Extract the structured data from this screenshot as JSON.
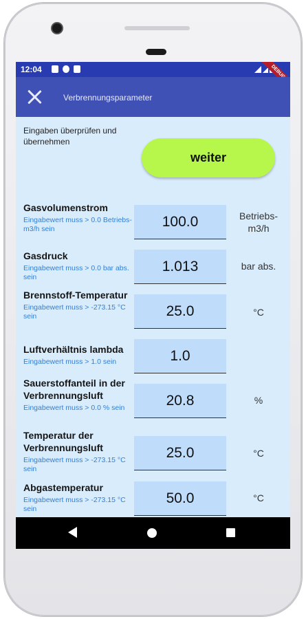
{
  "status_bar": {
    "time": "12:04",
    "debug_banner": "DEBUG"
  },
  "app_bar": {
    "title": "Verbrennungsparameter"
  },
  "hint": "Eingaben überprüfen und übernehmen",
  "weiter_label": "weiter",
  "params": [
    {
      "label": "Gasvolumenstrom",
      "hint": "Eingabewert muss > 0.0 Betriebs-m3/h sein",
      "value": "100.0",
      "unit": "Betriebs-m3/h"
    },
    {
      "label": "Gasdruck",
      "hint": "Eingabewert muss > 0.0 bar abs. sein",
      "value": "1.013",
      "unit": "bar abs."
    },
    {
      "label": "Brennstoff-Temperatur",
      "hint": "Eingabewert muss > -273.15 °C sein",
      "value": "25.0",
      "unit": "°C"
    },
    {
      "label": "Luftverhältnis lambda",
      "hint": "Eingabewert muss > 1.0 sein",
      "value": "1.0",
      "unit": ""
    },
    {
      "label": "Sauerstoffanteil in der Verbrennungsluft",
      "hint": "Eingabewert muss > 0.0 % sein",
      "value": "20.8",
      "unit": "%"
    },
    {
      "label": "Temperatur der Verbrennungsluft",
      "hint": "Eingabewert muss > -273.15 °C sein",
      "value": "25.0",
      "unit": "°C"
    },
    {
      "label": "Abgastemperatur",
      "hint": "Eingabewert muss > -273.15 °C sein",
      "value": "50.0",
      "unit": "°C"
    }
  ]
}
